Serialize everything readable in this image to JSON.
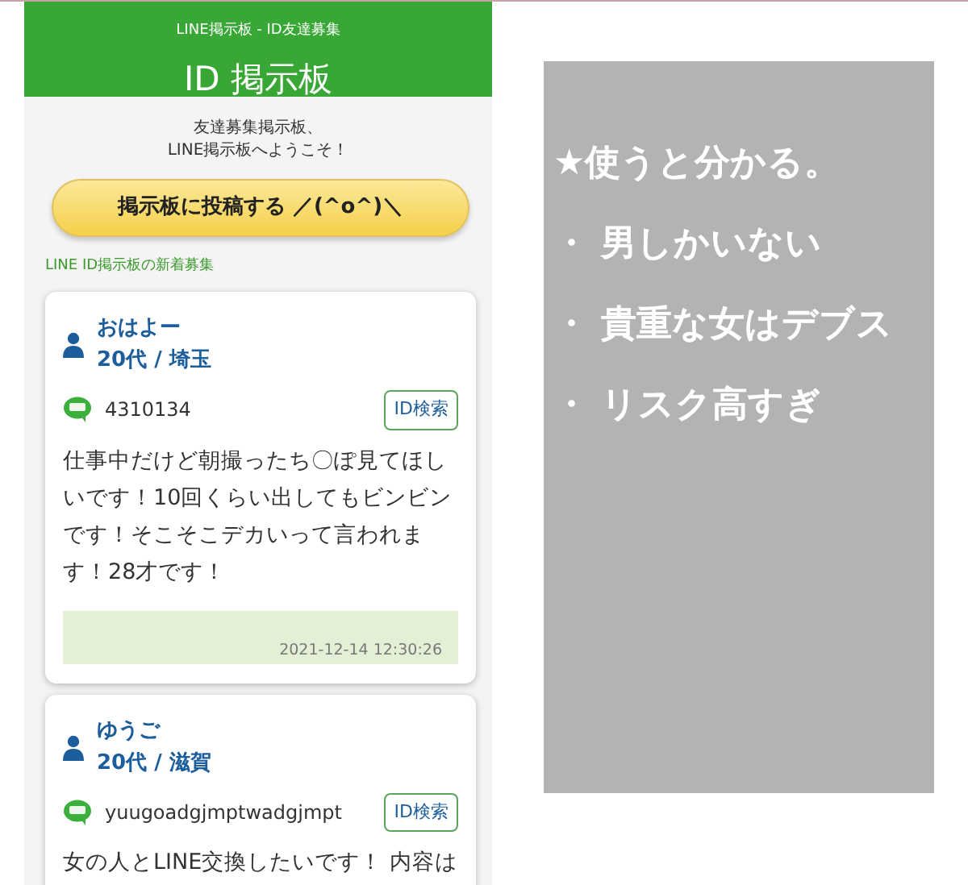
{
  "header": {
    "subtitle": "LINE掲示板 - ID友達募集",
    "title": "ID 掲示板"
  },
  "welcome": [
    "友達募集掲示板、",
    "LINE掲示板へようこそ！"
  ],
  "post_button": "掲示板に投稿する ／(^o^)＼",
  "section_title": "LINE ID掲示板の新着募集",
  "posts": [
    {
      "name": "おはよー",
      "profile": "20代 / 埼玉",
      "line_id": "4310134",
      "search_button": "ID検索",
      "message": "仕事中だけど朝撮ったち〇ぽ見てほしいです！10回くらい出してもビンビンです！そこそこデカいって言われます！28才です！",
      "date": "2021-12-14 12:30:26"
    },
    {
      "name": "ゆうご",
      "profile": "20代 / 滋賀",
      "line_id": "yuugoadgjmptwadgjmpt",
      "search_button": "ID検索",
      "message": "女の人とLINE交換したいです！ 内容は"
    }
  ],
  "overlay": {
    "heading": "★使うと分かる。",
    "items": [
      "・ 男しかいない",
      "・ 貴重な女はデブス",
      "・ リスク高すぎ"
    ]
  }
}
